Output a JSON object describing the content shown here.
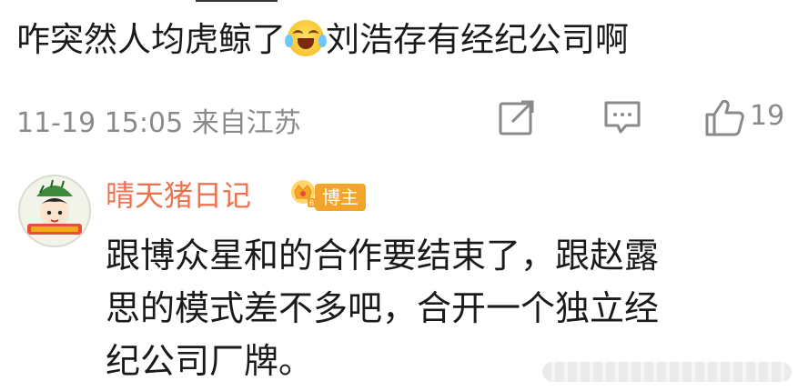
{
  "comment": {
    "text_before_emoji": "咋突然人均虎鲸了",
    "emoji": "laugh-cry-emoji",
    "text_after_emoji": "刘浩存有经纪公司啊"
  },
  "meta": {
    "datetime": "11-19 15:05",
    "location": "来自江苏",
    "like_count": "19"
  },
  "reply": {
    "username": "晴天猪日记",
    "badge": "博主",
    "lines": [
      "跟博众星和的合作要结束了，跟赵露",
      "思的模式差不多吧，合开一个独立经",
      "纪公司厂牌。"
    ]
  },
  "colors": {
    "username": "#eb7350",
    "badge_bg": "#f3a42b",
    "meta_gray": "#8a8a8a"
  }
}
